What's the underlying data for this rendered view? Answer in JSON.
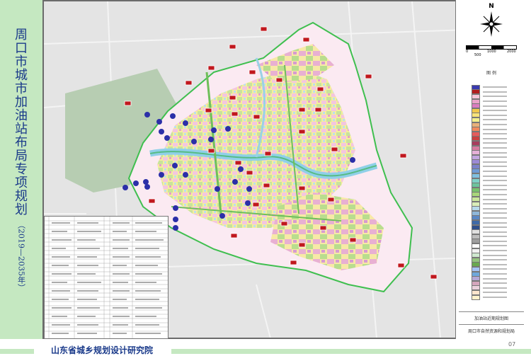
{
  "title": {
    "chars": [
      "周",
      "口",
      "市",
      "城",
      "市",
      "加",
      "油",
      "站",
      "布",
      "局",
      "专",
      "项",
      "规",
      "划"
    ],
    "year": "（2019—2035年）"
  },
  "map": {
    "north_label": "N",
    "scale_labels": [
      "0",
      "500",
      "1000",
      "2000"
    ],
    "legend_title": "图 例",
    "legend_colors": [
      "#3a3ab0",
      "#b01e1e",
      "#f6c6d8",
      "#e9a3c9",
      "#d97cc0",
      "#f2c94c",
      "#f7e37a",
      "#f3f08d",
      "#e8b07a",
      "#f08a5d",
      "#e55b5b",
      "#c94040",
      "#a83c5e",
      "#d67aa0",
      "#e6b0d8",
      "#c2a6e0",
      "#9d8ad6",
      "#7c82c9",
      "#6f9bd6",
      "#80c0e0",
      "#7fd1c7",
      "#6cc39d",
      "#79c26b",
      "#a8d67a",
      "#c9e59a",
      "#d9edb8",
      "#b6d9ea",
      "#8fb7d9",
      "#5a87c4",
      "#3f6aa8",
      "#2f4f8a",
      "#e0e0e0",
      "#bdbdbd",
      "#9e9e9e",
      "#ffffff",
      "#f2f2f2",
      "#cfe8cf",
      "#93c47d",
      "#6aa84f",
      "#a4c2f4",
      "#6fa8dc",
      "#b4a7d6",
      "#d5a6bd",
      "#ead1dc",
      "#fce5cd",
      "#fff2cc"
    ],
    "plan_name": "加油站近期规划图",
    "dept_name": "周口市自然资源和规划局",
    "page_number": "07"
  },
  "footer": {
    "institute": "山东省城乡规划设计研究院"
  }
}
